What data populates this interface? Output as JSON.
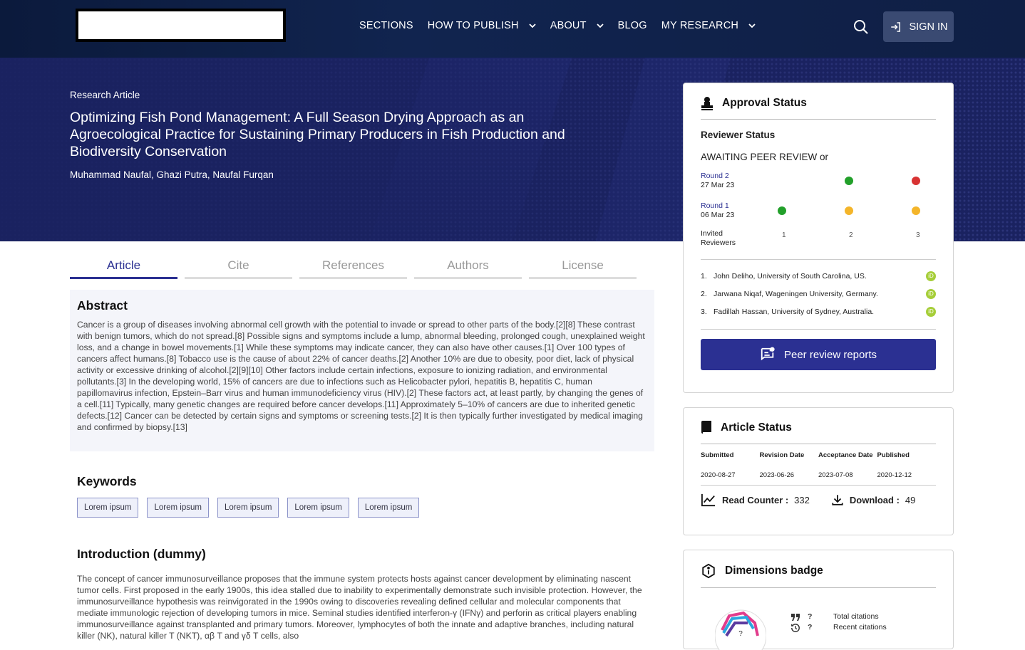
{
  "nav": {
    "items": [
      {
        "label": "SECTIONS",
        "dropdown": false
      },
      {
        "label": "HOW TO PUBLISH",
        "dropdown": true
      },
      {
        "label": "ABOUT",
        "dropdown": true
      },
      {
        "label": "BLOG",
        "dropdown": false
      },
      {
        "label": "MY RESEARCH",
        "dropdown": true
      }
    ],
    "sign_in": "SIGN IN"
  },
  "hero": {
    "type": "Research Article",
    "title": "Optimizing Fish Pond Management: A Full Season Drying Approach as an Agroecological Practice for Sustaining Primary Producers in Fish Production and Biodiversity Conservation",
    "authors": "Muhammad Naufal, Ghazi Putra, Naufal Furqan"
  },
  "tabs": [
    "Article",
    "Cite",
    "References",
    "Authors",
    "License"
  ],
  "abstract": {
    "heading": "Abstract",
    "text": "Cancer is a group of diseases involving abnormal cell growth with the potential to invade or spread to other parts of the body.[2][8] These contrast with benign tumors, which do not spread.[8] Possible signs and symptoms include a lump, abnormal bleeding, prolonged cough, unexplained weight loss, and a change in bowel movements.[1] While these symptoms may indicate cancer, they can also have other causes.[1] Over 100 types of cancers affect humans.[8] Tobacco use is the cause of about 22% of cancer deaths.[2] Another 10% are due to obesity, poor diet, lack of physical activity or excessive drinking of alcohol.[2][9][10] Other factors include certain infections, exposure to ionizing radiation, and environmental pollutants.[3] In the developing world, 15% of cancers are due to infections such as Helicobacter pylori, hepatitis B, hepatitis C, human papillomavirus infection, Epstein–Barr virus and human immunodeficiency virus (HIV).[2] These factors act, at least partly, by changing the genes of a cell.[11] Typically, many genetic changes are required before cancer develops.[11] Approximately 5–10% of cancers are due to inherited genetic defects.[12] Cancer can be detected by certain signs and symptoms or screening tests.[2] It is then typically further investigated by medical imaging and confirmed by biopsy.[13]"
  },
  "keywords": {
    "heading": "Keywords",
    "items": [
      "Lorem ipsum",
      "Lorem ipsum",
      "Lorem ipsum",
      "Lorem ipsum",
      "Lorem ipsum"
    ]
  },
  "intro": {
    "heading": "Introduction (dummy)",
    "text": "The concept of cancer immunosurveillance proposes that the immune system protects hosts against cancer development by eliminating nascent tumor cells. First proposed in the early 1900s, this idea stalled due to inability to experimentally demonstrate such invisible protection. However, the immunosurveillance hypothesis was reinvigorated in the 1990s owing to discoveries revealing defined cellular and molecular components that mediate immunologic rejection of developing tumors in mice. Seminal studies identified interferon-γ (IFNγ) and perforin as critical players enabling immunosurveillance against transplanted and primary tumors. Moreover, lymphocytes of both the innate and adaptive branches, including natural killer (NK), natural killer T (NKT), αβ T and γδ T cells, also"
  },
  "approval": {
    "heading": "Approval Status",
    "reviewer_status": "Reviewer Status",
    "awaiting": "AWAITING PEER REVIEW or",
    "rounds": [
      {
        "name": "Round 2",
        "date": "27 Mar 23",
        "dots": [
          "",
          "#22a02a",
          "#d83333"
        ]
      },
      {
        "name": "Round 1",
        "date": "06 Mar 23",
        "dots": [
          "#22a02a",
          "#f4b52a",
          "#f4b52a"
        ]
      }
    ],
    "invited_label": "Invited Reviewers",
    "invited_numbers": [
      "1",
      "2",
      "3"
    ],
    "reviewers": [
      {
        "idx": "1.",
        "name": "John Deliho, University of South Carolina, US."
      },
      {
        "idx": "2.",
        "name": "Jarwana Niqaf, Wageningen University, Germany."
      },
      {
        "idx": "3.",
        "name": "Fadillah Hassan, University of Sydney, Australia."
      }
    ],
    "button": "Peer review reports"
  },
  "article_status": {
    "heading": "Article Status",
    "columns": [
      {
        "label": "Submitted",
        "value": "2020-08-27"
      },
      {
        "label": "Revision Date",
        "value": "2023-06-26"
      },
      {
        "label": "Acceptance Date",
        "value": "2023-07-08"
      },
      {
        "label": "Published",
        "value": "2020-12-12"
      }
    ],
    "read_counter_label": "Read Counter :",
    "read_counter": "332",
    "download_label": "Download :",
    "download": "49"
  },
  "dimensions": {
    "heading": "Dimensions badge",
    "badge_value": "?",
    "rows": [
      {
        "value": "?",
        "label": "Total citations"
      },
      {
        "value": "?",
        "label": "Recent citations"
      }
    ]
  }
}
